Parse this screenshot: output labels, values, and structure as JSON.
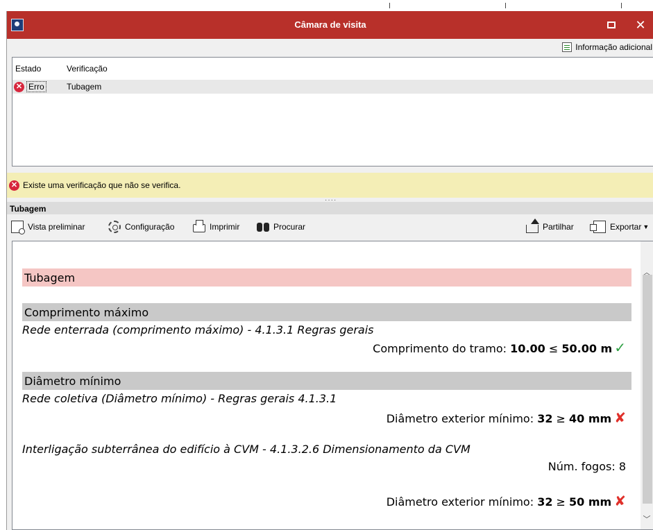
{
  "window": {
    "title": "Câmara de visita"
  },
  "info_bar": {
    "button_label": "Informação adicional"
  },
  "grid": {
    "headers": {
      "estado": "Estado",
      "verificacao": "Verificação"
    },
    "rows": [
      {
        "estado": "Erro",
        "verificacao": "Tubagem"
      }
    ]
  },
  "warning": {
    "text": "Existe uma verificação que não se verifica."
  },
  "section": {
    "title": "Tubagem"
  },
  "toolbar": {
    "preview": "Vista preliminar",
    "config": "Configuração",
    "print": "Imprimir",
    "find": "Procurar",
    "share": "Partilhar",
    "export": "Exportar"
  },
  "report": {
    "title": "Tubagem",
    "sections": [
      {
        "heading": "Comprimento máximo",
        "rule": "Rede enterrada (comprimento máximo) - 4.1.3.1 Regras gerais",
        "check": {
          "label": "Comprimento do tramo:",
          "value": "10.00",
          "op": "≤",
          "limit": "50.00 m",
          "status": "ok"
        }
      },
      {
        "heading": "Diâmetro mínimo",
        "rule": "Rede coletiva (Diâmetro mínimo) - Regras gerais 4.1.3.1",
        "check": {
          "label": "Diâmetro exterior mínimo:",
          "value": "32",
          "op": "≥",
          "limit": "40 mm",
          "status": "fail"
        },
        "rule2": "Interligação subterrânea do edifício à CVM - 4.1.3.2.6 Dimensionamento da CVM",
        "fogos": "Núm. fogos: 8",
        "check2": {
          "label": "Diâmetro exterior mínimo:",
          "value": "32",
          "op": "≥",
          "limit": "50 mm",
          "status": "fail"
        }
      }
    ]
  },
  "icons": {
    "app": "app-icon",
    "maximize": "maximize-icon",
    "close": "close-icon",
    "info": "info-icon",
    "error": "error-icon",
    "preview": "preview-icon",
    "config": "gear-icon",
    "print": "printer-icon",
    "find": "binoculars-icon",
    "share": "share-icon",
    "export": "export-icon",
    "ok": "check-icon",
    "fail": "cross-icon"
  },
  "colors": {
    "titlebar": "#b8302a",
    "warning_bg": "#f4eeb6",
    "report_title_bg": "#f5c6c4",
    "subsection_bg": "#c9c9c9",
    "ok": "#2ea043",
    "fail": "#e0302a"
  }
}
